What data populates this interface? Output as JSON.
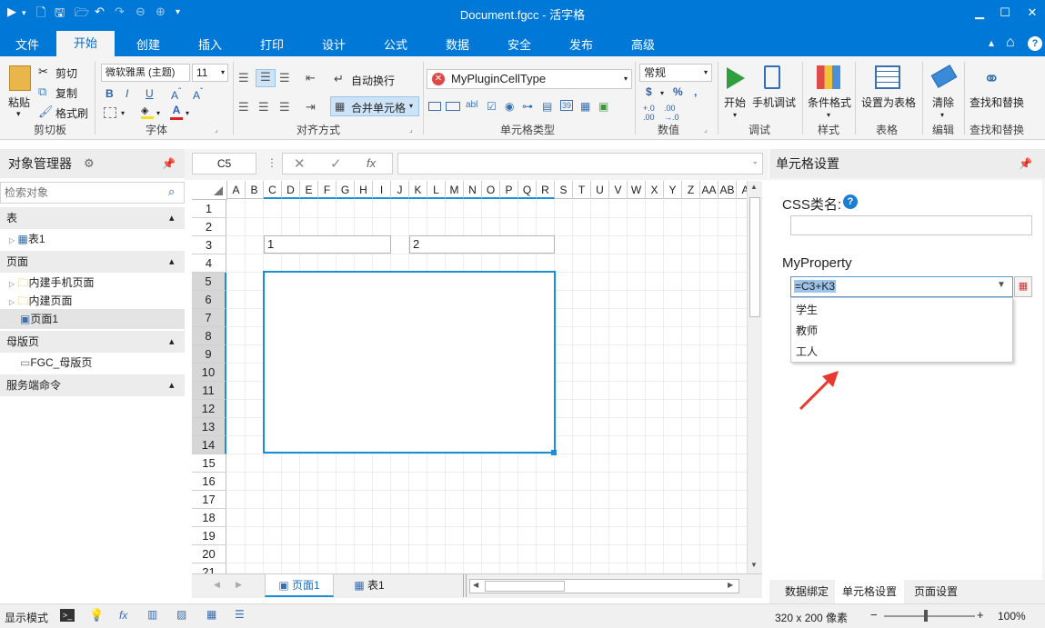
{
  "app": {
    "title": "Document.fgcc - 活字格"
  },
  "menu_tabs": [
    "文件",
    "开始",
    "创建",
    "插入",
    "打印",
    "设计",
    "公式",
    "数据",
    "安全",
    "发布",
    "高级"
  ],
  "ribbon": {
    "paste": "粘贴",
    "cut": "剪切",
    "copy": "复制",
    "format_painter": "格式刷",
    "clipboard_group": "剪切板",
    "font_name": "微软雅黑 (主题)",
    "font_size": "11",
    "font_group": "字体",
    "wrap_text": "自动换行",
    "merge_cells": "合并单元格",
    "align_group": "对齐方式",
    "cell_type": "MyPluginCellType",
    "cell_type_group": "单元格类型",
    "number_format": "常规",
    "number_group": "数值",
    "start": "开始",
    "mobile_debug": "手机调试",
    "debug_group": "调试",
    "cond_format": "条件格式",
    "style_group": "样式",
    "set_table": "设置为表格",
    "table_group": "表格",
    "clear": "清除",
    "edit_group": "编辑",
    "find_replace": "查找和替换",
    "find_group": "查找和替换"
  },
  "left_panel": {
    "title": "对象管理器",
    "search_placeholder": "检索对象",
    "sections": {
      "tables": "表",
      "pages": "页面",
      "masters": "母版页",
      "server": "服务端命令"
    },
    "tables": [
      "表1"
    ],
    "pages": [
      "内建手机页面",
      "内建页面",
      "页面1"
    ],
    "masters": [
      "FGC_母版页"
    ]
  },
  "formula_bar": {
    "cell_ref": "C5",
    "fx": "fx"
  },
  "grid": {
    "columns": [
      "A",
      "B",
      "C",
      "D",
      "E",
      "F",
      "G",
      "H",
      "I",
      "J",
      "K",
      "L",
      "M",
      "N",
      "O",
      "P",
      "Q",
      "R",
      "S",
      "T",
      "U",
      "V",
      "W",
      "X",
      "Y",
      "Z",
      "AA",
      "AB",
      "A"
    ],
    "rows": [
      "1",
      "2",
      "3",
      "4",
      "5",
      "6",
      "7",
      "8",
      "9",
      "10",
      "11",
      "12",
      "13",
      "14",
      "15",
      "16",
      "17",
      "18",
      "19",
      "20",
      "21"
    ],
    "cell_c3": "1",
    "cell_k3": "2"
  },
  "sheet_tabs": [
    "页面1",
    "表1"
  ],
  "right_panel": {
    "title": "单元格设置",
    "css_label": "CSS类名:",
    "my_property_label": "MyProperty",
    "my_property_value": "=C3+K3",
    "dropdown_options": [
      "学生",
      "教师",
      "工人"
    ],
    "bottom_tabs": [
      "数据绑定",
      "单元格设置",
      "页面设置"
    ]
  },
  "status": {
    "display_mode": "显示模式",
    "size": "320 x 200 像素",
    "zoom": "100%"
  },
  "colors": {
    "accent": "#0078d7",
    "arrow": "#e8382f",
    "selection": "#1a8fd8"
  }
}
